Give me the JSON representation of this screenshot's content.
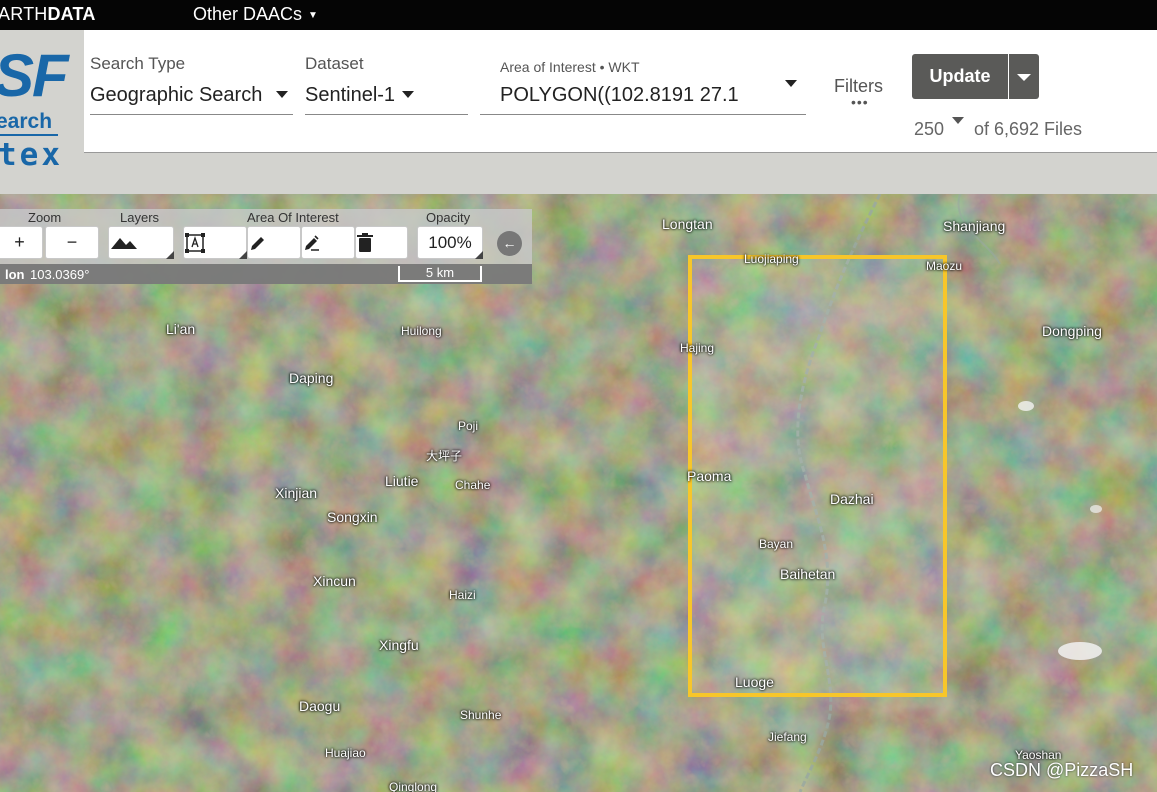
{
  "topbar": {
    "logo_light": "ARTH",
    "logo_bold": "DATA",
    "other_daacs": "Other DAACs"
  },
  "logo": {
    "sf": "SF",
    "search": "earch",
    "tex": "tex"
  },
  "search": {
    "type_label": "Search Type",
    "type_value": "Geographic Search",
    "dataset_label": "Dataset",
    "dataset_value": "Sentinel-1",
    "aoi_label": "Area of Interest • WKT",
    "aoi_value": "POLYGON((102.8191 27.1",
    "filters_label": "Filters",
    "filters_dots": "•••",
    "update_label": "Update",
    "max_results": "250",
    "files_count": "of 6,692 Files"
  },
  "map_controls": {
    "zoom_label": "Zoom",
    "zoom_in": "+",
    "zoom_out": "−",
    "layers_label": "Layers",
    "aoi_label": "Area Of Interest",
    "opacity_label": "Opacity",
    "opacity_value": "100%",
    "lon_label": "lon",
    "lon_value": "103.0369°",
    "scale": "5 km"
  },
  "map": {
    "places": [
      "Longtan",
      "Shanjiang",
      "Luojiaping",
      "Maozu",
      "Li'an",
      "Huilong",
      "Dongping",
      "Hajing",
      "Daping",
      "Poji",
      "大坪子",
      "Liutie",
      "Chahe",
      "Xinjian",
      "Songxin",
      "Paoma",
      "Dazhai",
      "Bayan",
      "Baihetan",
      "Xincun",
      "Haizi",
      "Xingfu",
      "Luoge",
      "Daogu",
      "Shunhe",
      "Jiefang",
      "Huajiao",
      "Qinglong",
      "Yaoshan"
    ]
  },
  "watermark": "CSDN @PizzaSH",
  "colors": {
    "aoi_box": "#f7c62a",
    "update_button": "#5a5a58",
    "logo_blue": "#1967a8"
  }
}
